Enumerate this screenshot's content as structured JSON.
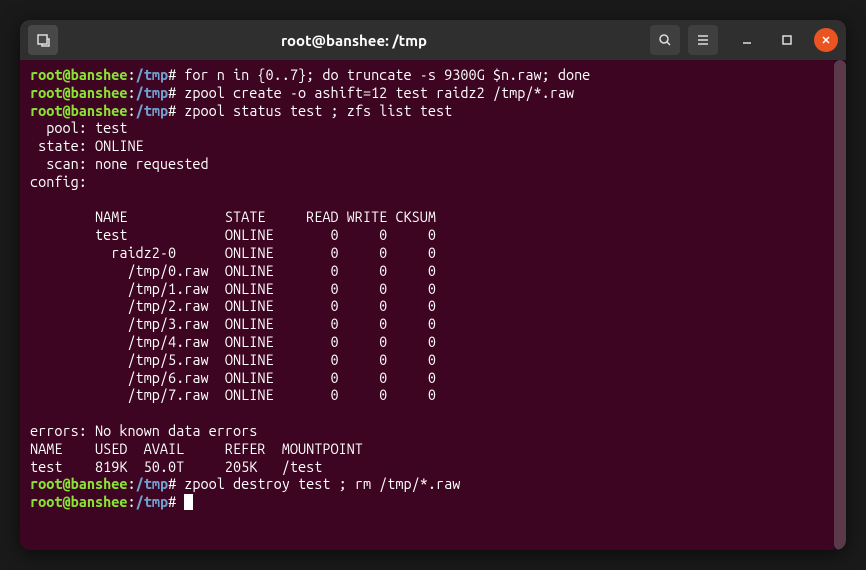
{
  "titlebar": {
    "title": "root@banshee: /tmp"
  },
  "prompt": {
    "user_host": "root@banshee",
    "sep": ":",
    "path": "/tmp",
    "hash": "#"
  },
  "commands": {
    "c1": "for n in {0..7}; do truncate -s 9300G $n.raw; done",
    "c2": "zpool create -o ashift=12 test raidz2 /tmp/*.raw",
    "c3": "zpool status test ; zfs list test",
    "c4": "zpool destroy test ; rm /tmp/*.raw"
  },
  "status": {
    "pool_label": "  pool:",
    "pool_value": "test",
    "state_label": " state:",
    "state_value": "ONLINE",
    "scan_label": "  scan:",
    "scan_value": "none requested",
    "config_label": "config:"
  },
  "config_header": {
    "name": "NAME",
    "state": "STATE",
    "read": "READ",
    "write": "WRITE",
    "cksum": "CKSUM"
  },
  "config_rows": [
    {
      "name": "test",
      "indent": 8,
      "state": "ONLINE",
      "read": "0",
      "write": "0",
      "cksum": "0"
    },
    {
      "name": "raidz2-0",
      "indent": 10,
      "state": "ONLINE",
      "read": "0",
      "write": "0",
      "cksum": "0"
    },
    {
      "name": "/tmp/0.raw",
      "indent": 12,
      "state": "ONLINE",
      "read": "0",
      "write": "0",
      "cksum": "0"
    },
    {
      "name": "/tmp/1.raw",
      "indent": 12,
      "state": "ONLINE",
      "read": "0",
      "write": "0",
      "cksum": "0"
    },
    {
      "name": "/tmp/2.raw",
      "indent": 12,
      "state": "ONLINE",
      "read": "0",
      "write": "0",
      "cksum": "0"
    },
    {
      "name": "/tmp/3.raw",
      "indent": 12,
      "state": "ONLINE",
      "read": "0",
      "write": "0",
      "cksum": "0"
    },
    {
      "name": "/tmp/4.raw",
      "indent": 12,
      "state": "ONLINE",
      "read": "0",
      "write": "0",
      "cksum": "0"
    },
    {
      "name": "/tmp/5.raw",
      "indent": 12,
      "state": "ONLINE",
      "read": "0",
      "write": "0",
      "cksum": "0"
    },
    {
      "name": "/tmp/6.raw",
      "indent": 12,
      "state": "ONLINE",
      "read": "0",
      "write": "0",
      "cksum": "0"
    },
    {
      "name": "/tmp/7.raw",
      "indent": 12,
      "state": "ONLINE",
      "read": "0",
      "write": "0",
      "cksum": "0"
    }
  ],
  "errors_line": "errors: No known data errors",
  "zfs_header": {
    "name": "NAME",
    "used": "USED",
    "avail": "AVAIL",
    "refer": "REFER",
    "mountpoint": "MOUNTPOINT"
  },
  "zfs_row": {
    "name": "test",
    "used": "819K",
    "avail": "50.0T",
    "refer": "205K",
    "mountpoint": "/test"
  }
}
